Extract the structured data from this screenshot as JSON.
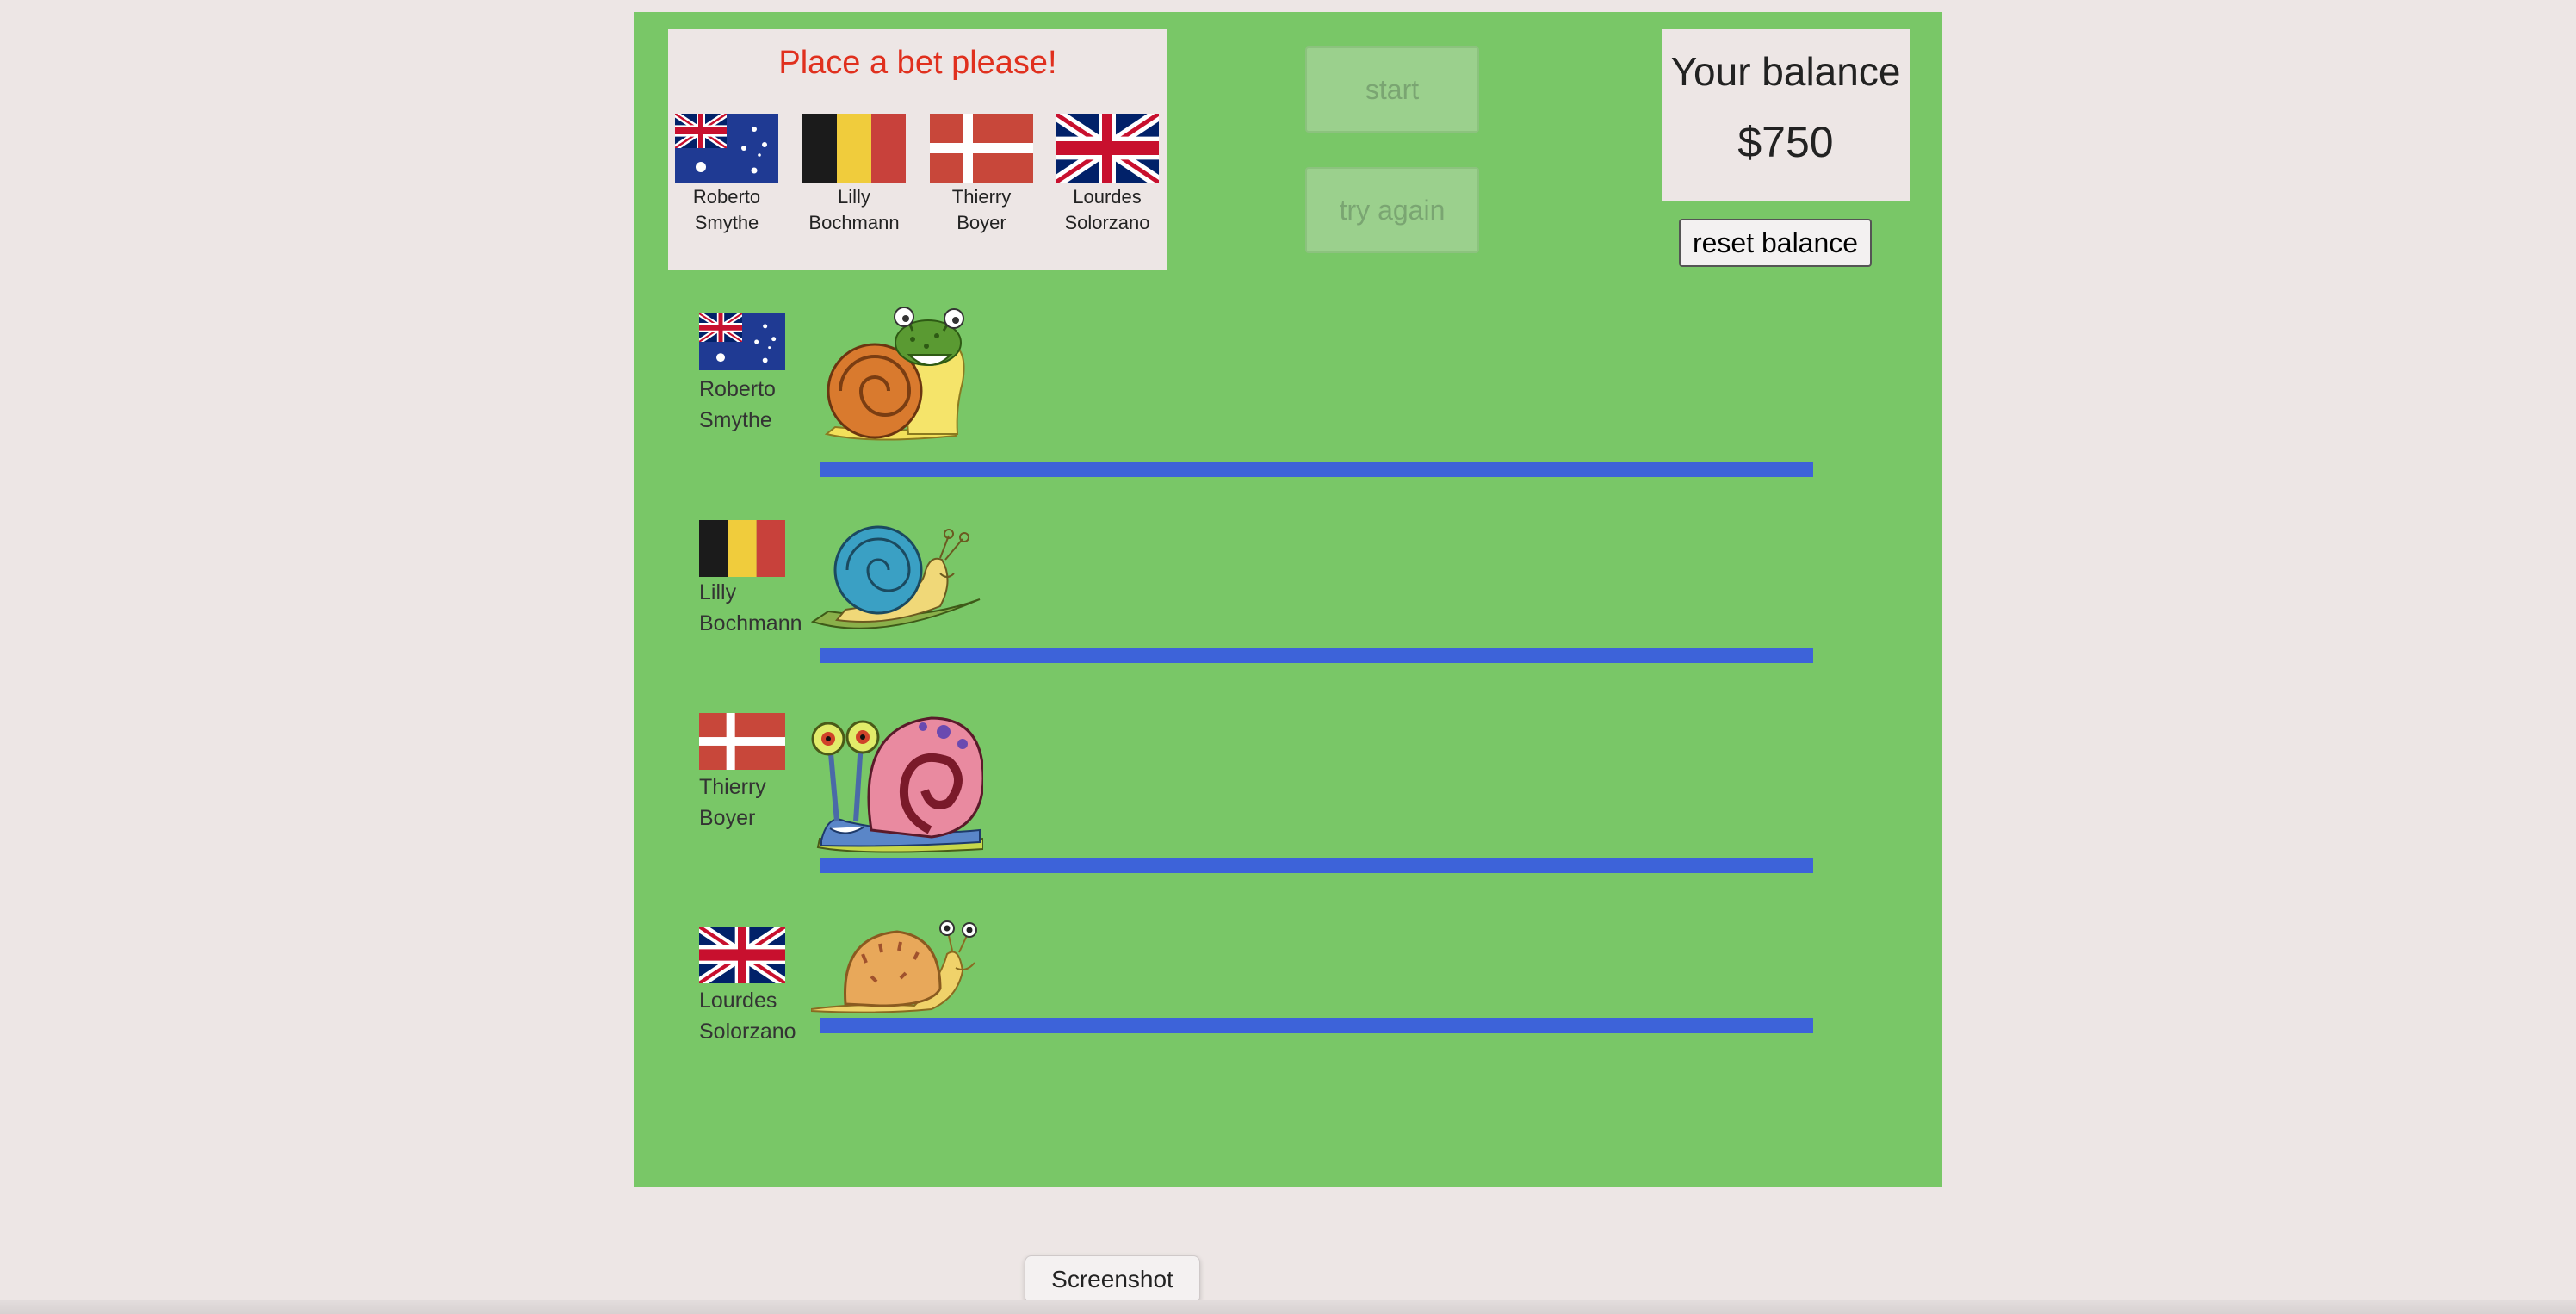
{
  "bet_panel": {
    "title": "Place a bet please!",
    "options": [
      {
        "first": "Roberto",
        "last": "Smythe",
        "flag": "australia-flag"
      },
      {
        "first": "Lilly",
        "last": "Bochmann",
        "flag": "belgium-flag"
      },
      {
        "first": "Thierry",
        "last": "Boyer",
        "flag": "denmark-flag"
      },
      {
        "first": "Lourdes",
        "last": "Solorzano",
        "flag": "uk-flag"
      }
    ]
  },
  "controls": {
    "start_label": "start",
    "try_again_label": "try again",
    "reset_label": "reset balance"
  },
  "balance": {
    "label": "Your balance",
    "value": "$750"
  },
  "lanes": [
    {
      "first": "Roberto",
      "last": "Smythe",
      "flag": "australia-flag",
      "snail": "green-snail-icon"
    },
    {
      "first": "Lilly",
      "last": "Bochmann",
      "flag": "belgium-flag",
      "snail": "blue-snail-icon"
    },
    {
      "first": "Thierry",
      "last": "Boyer",
      "flag": "denmark-flag",
      "snail": "pink-snail-icon"
    },
    {
      "first": "Lourdes",
      "last": "Solorzano",
      "flag": "uk-flag",
      "snail": "orange-snail-icon"
    }
  ],
  "tooltip": "Screenshot",
  "colors": {
    "board": "#79c767",
    "track": "#3d63d9",
    "title": "#e0301e"
  }
}
